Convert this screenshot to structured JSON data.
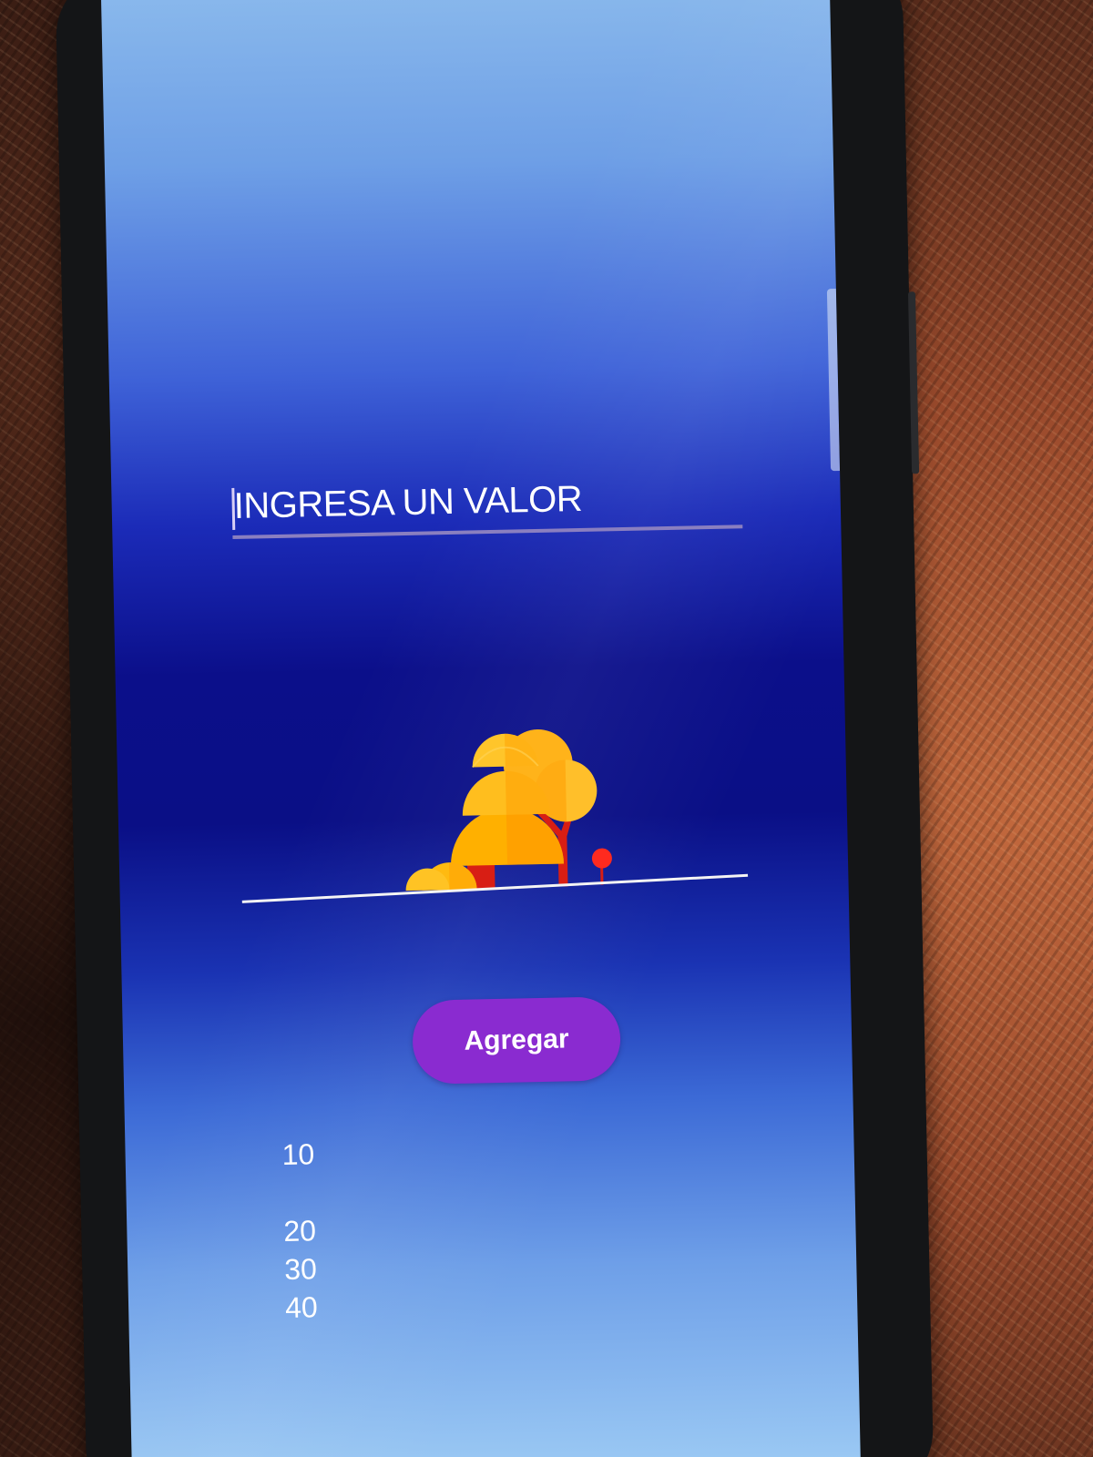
{
  "input": {
    "value": "INGRESA UN VALOR"
  },
  "button": {
    "label": "Agregar"
  },
  "list": {
    "items": [
      "10",
      "20",
      "30",
      "40"
    ]
  },
  "colors": {
    "button": "#8a2bd0",
    "input_underline": "#8a7fc0",
    "tree_yellow": "#ffb000",
    "trunk_red": "#d81e14"
  }
}
